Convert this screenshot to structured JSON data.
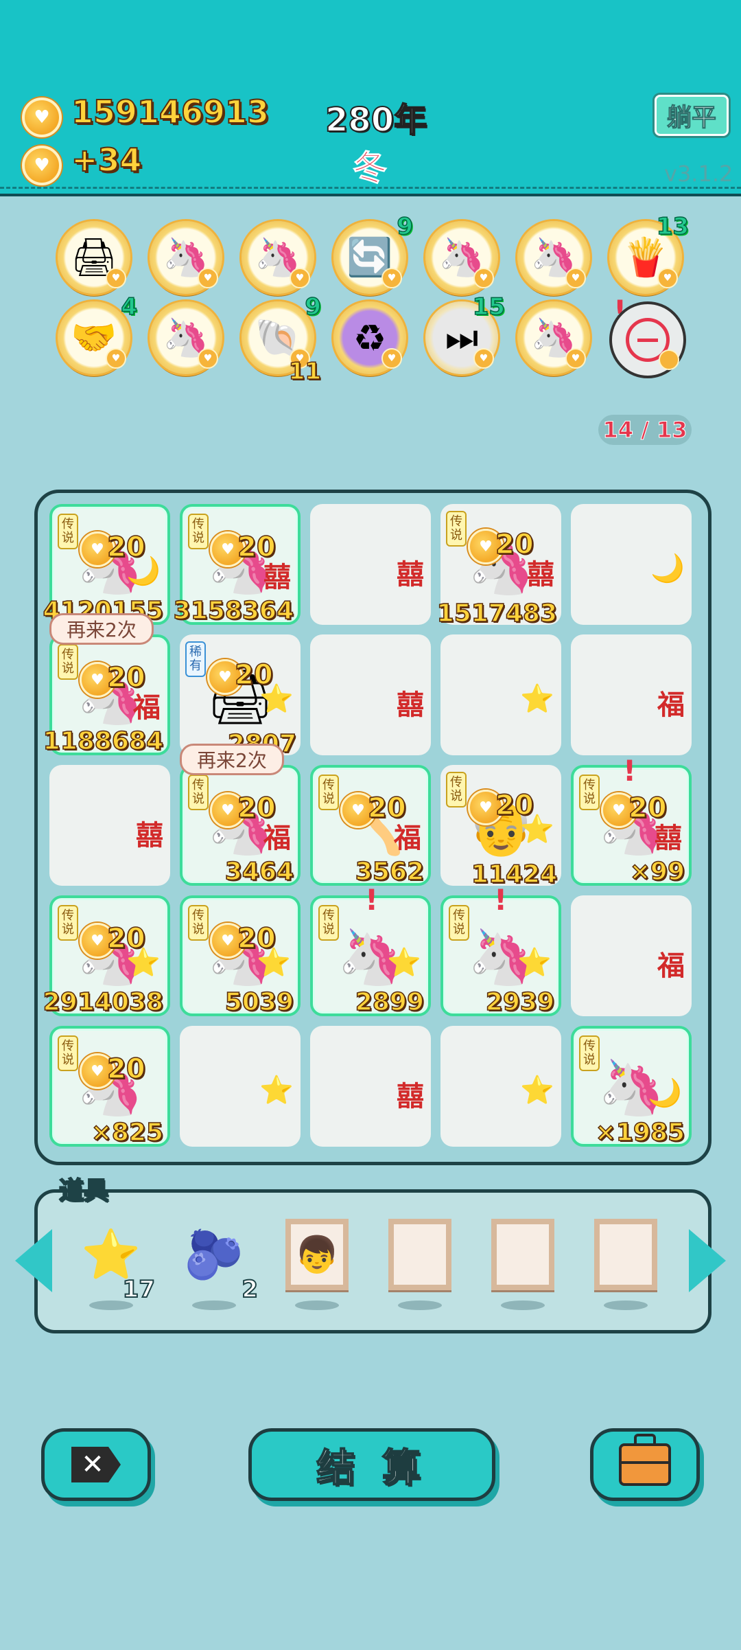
{
  "header": {
    "coins": "159146913",
    "income": "+34",
    "year": "280年",
    "season": "冬",
    "lie_flat_label": "躺平",
    "version": "v3.1.2"
  },
  "relics": {
    "row1": [
      {
        "icon": "printer-icon",
        "glyph": "🖨",
        "count": ""
      },
      {
        "icon": "unicorn-icon",
        "glyph": "🦄",
        "count": ""
      },
      {
        "icon": "unicorn-icon",
        "glyph": "🦄",
        "count": ""
      },
      {
        "icon": "recycle-arrows-icon",
        "glyph": "🔄",
        "count": "9"
      },
      {
        "icon": "unicorn-icon",
        "glyph": "🦄",
        "count": ""
      },
      {
        "icon": "unicorn-icon",
        "glyph": "🦄",
        "count": ""
      },
      {
        "icon": "fries-icon",
        "glyph": "🍟",
        "count": "13"
      }
    ],
    "row2": [
      {
        "icon": "handshake-icon",
        "glyph": "🤝",
        "count": "4"
      },
      {
        "icon": "unicorn-icon",
        "glyph": "🦄",
        "count": ""
      },
      {
        "icon": "shell-icon",
        "glyph": "🐚",
        "count": "9",
        "count2": "11"
      },
      {
        "icon": "recycle-icon",
        "glyph": "♻",
        "count": ""
      },
      {
        "icon": "skip-icon",
        "glyph": "⏭",
        "count": "15"
      },
      {
        "icon": "unicorn-icon",
        "glyph": "🦄",
        "count": ""
      }
    ],
    "remove_label": ""
  },
  "counter": "14 / 13",
  "board": {
    "tag_legend": "传说",
    "tag_rare": "稀有",
    "retry_label": "再来2次",
    "plus_value": "20",
    "cells": [
      {
        "glyph": "🦄",
        "side": "🌙",
        "value": "4120155",
        "rare": true,
        "tag": "传说",
        "plus": true
      },
      {
        "glyph": "🦄",
        "side": "囍",
        "value": "3158364",
        "rare": true,
        "tag": "传说",
        "plus": true
      },
      {
        "glyph": "",
        "side": "囍",
        "value": "",
        "rare": false,
        "tag": "",
        "plus": false
      },
      {
        "glyph": "🦄",
        "side": "囍",
        "value": "1517483",
        "rare": false,
        "tag": "传说",
        "plus": true
      },
      {
        "glyph": "",
        "side": "🌙",
        "value": "",
        "rare": false,
        "tag": "",
        "plus": false
      },
      {
        "glyph": "🦄",
        "side": "福",
        "value": "1188684",
        "rare": true,
        "tag": "传说",
        "plus": true
      },
      {
        "glyph": "🖨",
        "side": "⭐",
        "value": "2807",
        "rare": false,
        "tag": "稀有",
        "plus": true
      },
      {
        "glyph": "",
        "side": "囍",
        "value": "",
        "rare": false,
        "tag": "",
        "plus": false
      },
      {
        "glyph": "",
        "side": "⭐",
        "value": "",
        "rare": false,
        "tag": "",
        "plus": false
      },
      {
        "glyph": "",
        "side": "福",
        "value": "",
        "rare": false,
        "tag": "",
        "plus": false
      },
      {
        "glyph": "",
        "side": "囍",
        "value": "",
        "rare": false,
        "tag": "",
        "plus": false
      },
      {
        "glyph": "🦄",
        "side": "福",
        "value": "3464",
        "rare": true,
        "tag": "传说",
        "plus": true
      },
      {
        "glyph": "🪓",
        "side": "福",
        "value": "3562",
        "rare": true,
        "tag": "传说",
        "plus": true
      },
      {
        "glyph": "👴",
        "side": "⭐",
        "value": "11424",
        "rare": false,
        "tag": "传说",
        "plus": true
      },
      {
        "glyph": "🦄",
        "side": "囍",
        "value": "×99",
        "rare": true,
        "tag": "传说",
        "plus": true
      },
      {
        "glyph": "🦄",
        "side": "⭐",
        "value": "2914038",
        "rare": true,
        "tag": "传说",
        "plus": true
      },
      {
        "glyph": "🦄",
        "side": "⭐",
        "value": "5039",
        "rare": true,
        "tag": "传说",
        "plus": true
      },
      {
        "glyph": "🦄",
        "side": "⭐",
        "value": "2899",
        "rare": true,
        "tag": "传说",
        "plus": false
      },
      {
        "glyph": "🦄",
        "side": "⭐",
        "value": "2939",
        "rare": true,
        "tag": "传说",
        "plus": false
      },
      {
        "glyph": "",
        "side": "福",
        "value": "",
        "rare": false,
        "tag": "",
        "plus": false
      },
      {
        "glyph": "🦄",
        "side": "",
        "value": "×825",
        "rare": true,
        "tag": "传说",
        "plus": true
      },
      {
        "glyph": "",
        "side": "⭐",
        "value": "",
        "rare": false,
        "tag": "",
        "plus": false
      },
      {
        "glyph": "",
        "side": "囍",
        "value": "",
        "rare": false,
        "tag": "",
        "plus": false
      },
      {
        "glyph": "",
        "side": "⭐",
        "value": "",
        "rare": false,
        "tag": "",
        "plus": false
      },
      {
        "glyph": "🦄",
        "side": "🌙",
        "value": "×1985",
        "rare": true,
        "tag": "传说",
        "plus": false
      }
    ]
  },
  "items": {
    "title": "道具",
    "list": [
      {
        "icon": "star-icon",
        "glyph": "⭐",
        "qty": "17"
      },
      {
        "icon": "blueberry-icon",
        "glyph": "🫐",
        "qty": "2"
      },
      {
        "icon": "portrait-frame-icon",
        "glyph": "👦",
        "qty": ""
      },
      {
        "icon": "empty-frame-icon",
        "glyph": "",
        "qty": ""
      },
      {
        "icon": "empty-frame-icon",
        "glyph": "",
        "qty": ""
      },
      {
        "icon": "empty-frame-icon",
        "glyph": "",
        "qty": ""
      }
    ]
  },
  "footer": {
    "settle_label": "结 算"
  }
}
